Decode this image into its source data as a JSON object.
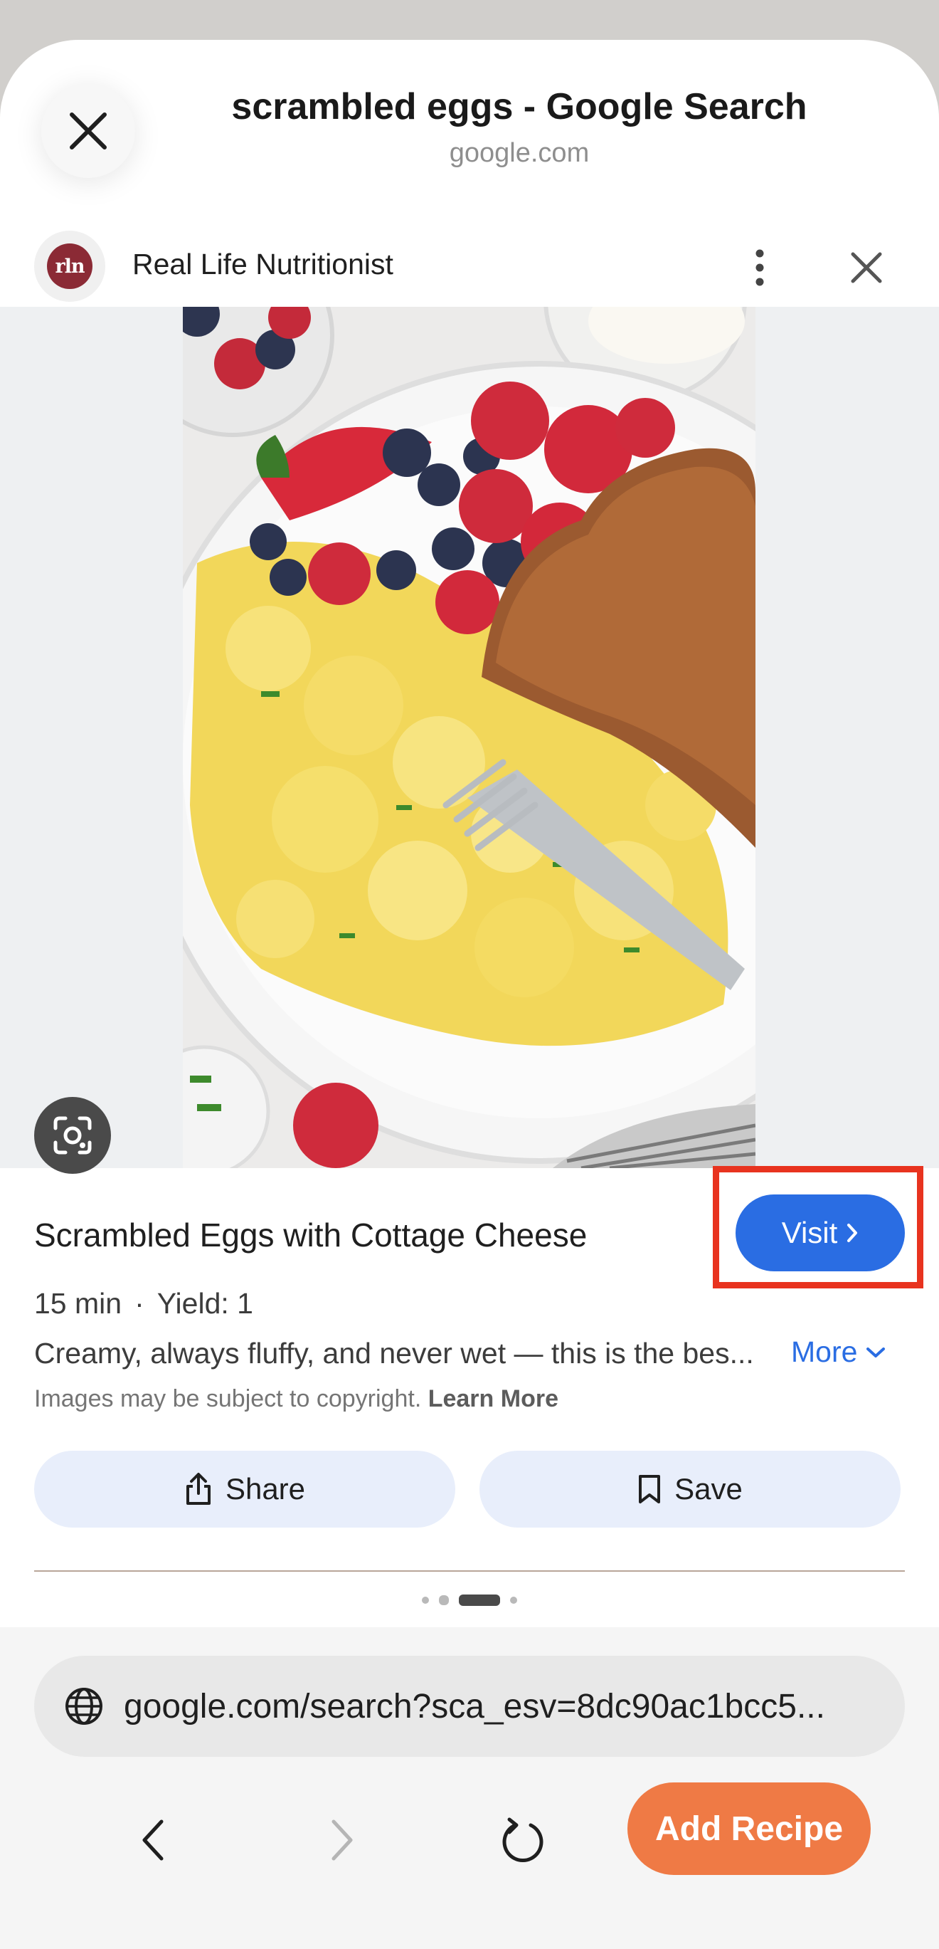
{
  "browser": {
    "page_title": "scrambled eggs - Google Search",
    "page_domain": "google.com",
    "close_icon": "close-icon",
    "url": "google.com/search?sca_esv=8dc90ac1bcc5..."
  },
  "source": {
    "logo_text": "rln",
    "name": "Real Life Nutritionist",
    "menu_icon": "more-vert-icon",
    "close_icon": "close-icon"
  },
  "image": {
    "subject": "scrambled eggs with berries and toast",
    "lens_icon": "google-lens-icon"
  },
  "recipe": {
    "title": "Scrambled Eggs with Cottage Cheese",
    "time": "15 min",
    "separator": "·",
    "yield": "Yield: 1",
    "description": "Creamy, always fluffy, and never wet — this is the bes...",
    "more_label": "More",
    "copyright_text": "Images may be subject to copyright.",
    "learn_more_label": "Learn More",
    "visit_label": "Visit"
  },
  "actions": {
    "share_label": "Share",
    "save_label": "Save"
  },
  "pager": {
    "count": 4,
    "active_index": 2
  },
  "toolbar": {
    "back_icon": "chevron-left-icon",
    "forward_icon": "chevron-right-icon",
    "reload_icon": "reload-icon",
    "add_recipe_label": "Add Recipe"
  },
  "colors": {
    "accent_blue": "#2a6de3",
    "highlight_red": "#e8331f",
    "add_recipe_orange": "#ef7a45",
    "pill_bg": "#e8eefb"
  }
}
